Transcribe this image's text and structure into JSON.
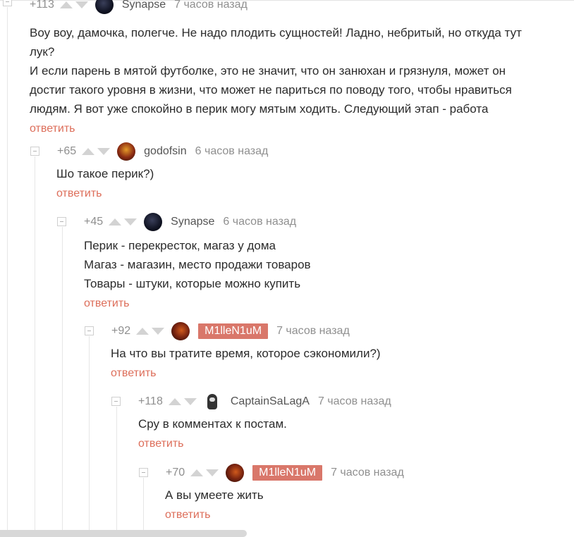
{
  "comments": [
    {
      "rating": "+113",
      "author": "Synapse",
      "time": "7 часов назад",
      "lines": [
        "Воу воу, дамочка, полегче. Не надо плодить сущностей! Ладно, небритый, но откуда тут",
        "лук?",
        "И если парень в мятой футболке, это не значит, что он занюхан и грязнуля, может он",
        "достиг такого уровня в жизни, что может не париться по поводу того, чтобы нравиться",
        "людям. Я вот уже спокойно в перик могу мятым ходить. Следующий этап - работа"
      ],
      "reply": "ответить"
    },
    {
      "rating": "+65",
      "author": "godofsin",
      "time": "6 часов назад",
      "lines": [
        "Шо такое перик?)"
      ],
      "reply": "ответить"
    },
    {
      "rating": "+45",
      "author": "Synapse",
      "time": "6 часов назад",
      "lines": [
        "Перик - перекресток, магаз у дома",
        "Магаз - магазин, место продажи товаров",
        "Товары - штуки, которые можно купить"
      ],
      "reply": "ответить"
    },
    {
      "rating": "+92",
      "author": "M1lleN1uM",
      "time": "7 часов назад",
      "lines": [
        "На что вы тратите время, которое сэкономили?)"
      ],
      "reply": "ответить"
    },
    {
      "rating": "+118",
      "author": "CaptainSaLagA",
      "time": "7 часов назад",
      "lines": [
        "Сру в комментах к постам."
      ],
      "reply": "ответить"
    },
    {
      "rating": "+70",
      "author": "M1lleN1uM",
      "time": "7 часов назад",
      "lines": [
        "А вы умеете жить"
      ],
      "reply": "ответить"
    }
  ]
}
